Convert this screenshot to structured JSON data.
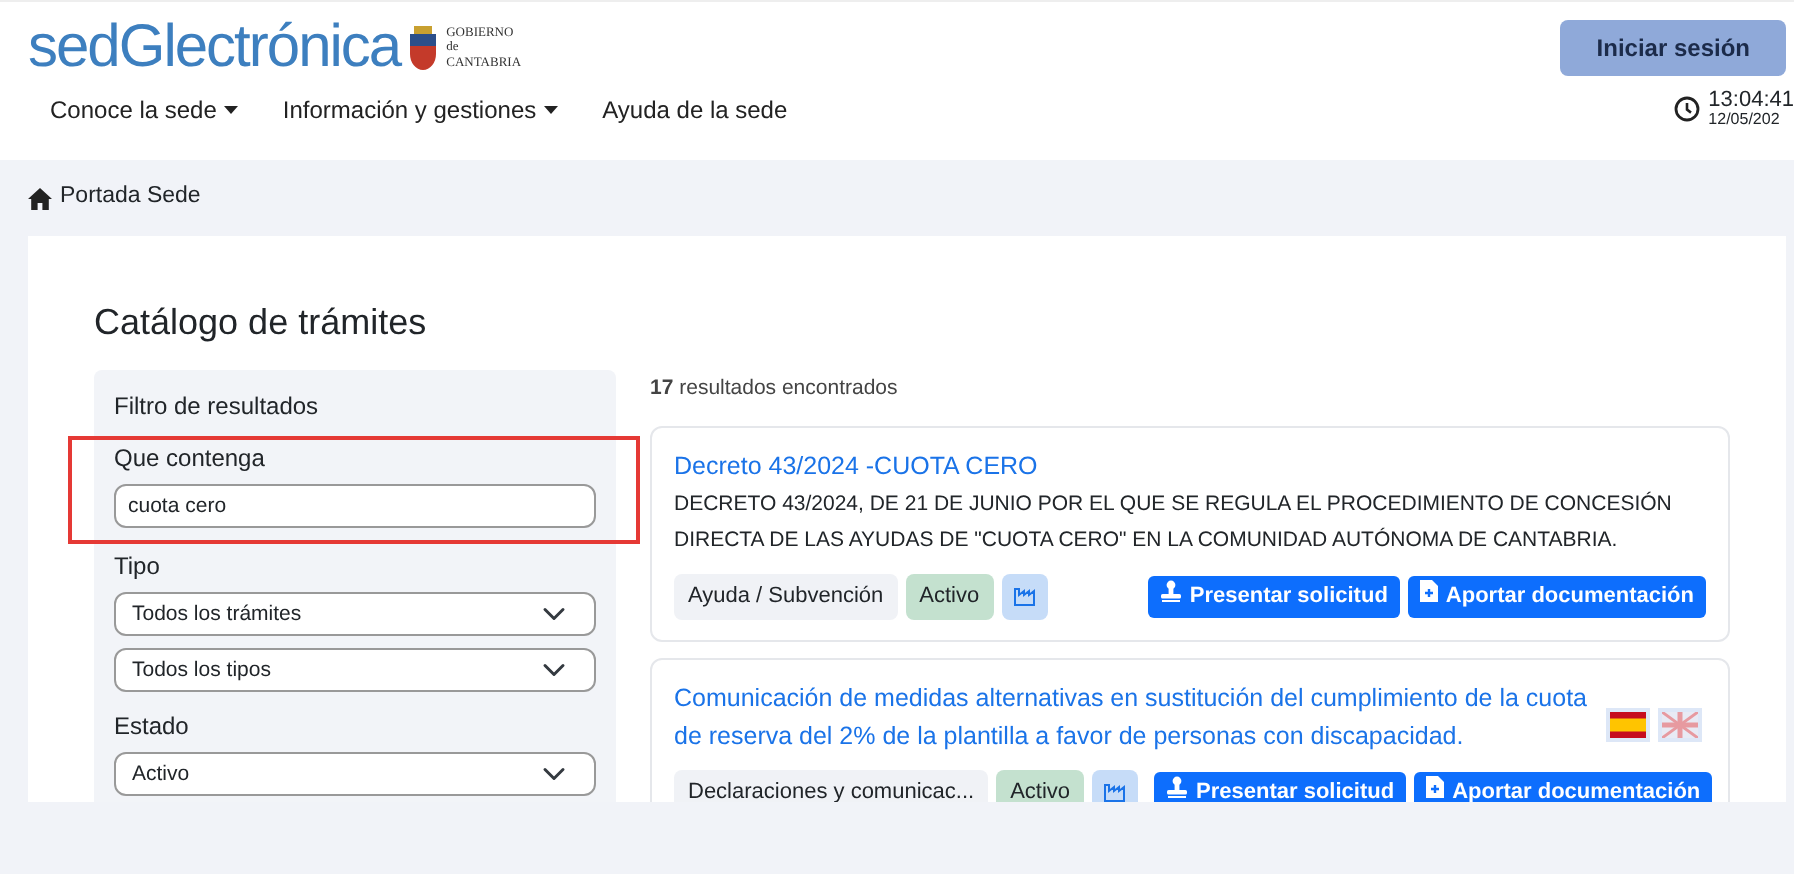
{
  "header": {
    "logo_text": "sedGlectrónica",
    "logo_subtitle": [
      "GOBIERNO",
      "de",
      "CANTABRIA"
    ],
    "login_button": "Iniciar sesión",
    "clock": {
      "time": "13:04:41",
      "date": "12/05/202"
    }
  },
  "nav": [
    {
      "label": "Conoce la sede",
      "dropdown": true
    },
    {
      "label": "Información y gestiones",
      "dropdown": true
    },
    {
      "label": "Ayuda de la sede",
      "dropdown": false
    }
  ],
  "breadcrumb": [
    "Portada Sede"
  ],
  "page_title": "Catálogo de trámites",
  "filter": {
    "title": "Filtro de resultados",
    "contains_label": "Que contenga",
    "contains_value": "cuota cero",
    "highlighted": true,
    "type_label": "Tipo",
    "type_selects": [
      "Todos los trámites",
      "Todos los tipos"
    ],
    "state_label": "Estado",
    "state_select": "Activo"
  },
  "results": {
    "count": "**17** resultados encontrados",
    "items": [
      {
        "title": "Decreto 43/2024 -CUOTA CERO",
        "description": "DECRETO 43/2024, DE 21 DE JUNIO POR EL QUE SE REGULA EL PROCEDIMIENTO DE CONCESIÓN DIRECTA DE LAS AYUDAS DE \"CUOTA CERO\" EN LA COMUNIDAD AUTÓNOMA DE CANTABRIA.",
        "category": "Ayuda / Subvención",
        "status": "Activo",
        "buttons": [
          "Presentar solicitud",
          "Aportar documentación"
        ]
      },
      {
        "title": "Comunicación de medidas alternativas en sustitución del cumplimiento de la cuota de reserva del 2% de la plantilla a favor de personas con discapacidad.",
        "category": "Declaraciones y comunicac...",
        "status": "Activo",
        "flags": [
          {
            "kind": "spain"
          },
          {
            "kind": "uk"
          }
        ],
        "buttons": [
          "Presentar solicitud",
          "Aportar documentación"
        ]
      }
    ]
  }
}
